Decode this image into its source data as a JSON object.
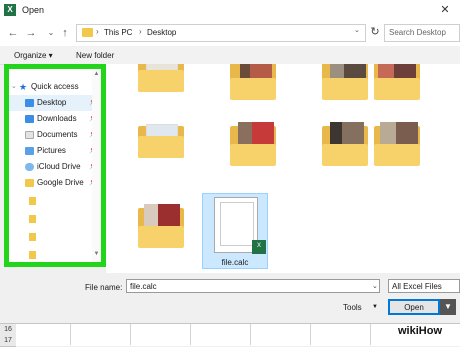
{
  "window": {
    "title": "Open",
    "app_icon": "excel-icon",
    "close_label": "✕"
  },
  "nav": {
    "back": "←",
    "forward": "→",
    "dropdown": "⌄",
    "up": "↑",
    "breadcrumb": [
      "This PC",
      "Desktop"
    ],
    "separator": "›",
    "refresh": "↻",
    "search_placeholder": "Search Desktop"
  },
  "toolbar": {
    "organize": "Organize ▾",
    "new_folder": "New folder"
  },
  "sidebar": {
    "header": "Quick access",
    "items": [
      {
        "label": "Desktop",
        "icon": "desktop-icon",
        "pinned": true
      },
      {
        "label": "Downloads",
        "icon": "download-icon",
        "pinned": true
      },
      {
        "label": "Documents",
        "icon": "documents-icon",
        "pinned": true
      },
      {
        "label": "Pictures",
        "icon": "pictures-icon",
        "pinned": true
      },
      {
        "label": "iCloud Drive",
        "icon": "icloud-icon",
        "pinned": true
      },
      {
        "label": "Google Drive",
        "icon": "google-drive-icon",
        "pinned": true
      }
    ],
    "pin_glyph": "📌",
    "highlight_color": "#22d41a"
  },
  "content": {
    "selected_file": {
      "name": "file.calc",
      "badge": "X"
    }
  },
  "bottom": {
    "file_name_label": "File name:",
    "file_name_value": "file.calc",
    "filter": "All Excel Files",
    "tools": "Tools",
    "open": "Open"
  },
  "excel": {
    "rows": [
      "16",
      "17"
    ]
  },
  "watermark": "wikiHow"
}
